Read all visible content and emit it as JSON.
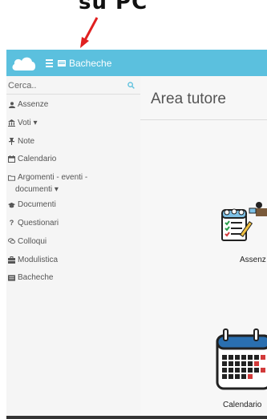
{
  "annotation": {
    "text": "su PC"
  },
  "topbar": {
    "menu_label": "Bacheche"
  },
  "sidebar": {
    "search_placeholder": "Cerca..",
    "items": [
      {
        "label": "Assenze",
        "icon": "user-icon"
      },
      {
        "label": "Voti ▾",
        "icon": "bank-icon"
      },
      {
        "label": "Note",
        "icon": "pin-icon"
      },
      {
        "label": "Calendario",
        "icon": "calendar-icon"
      },
      {
        "label": "Argomenti - eventi -",
        "label2": "documenti ▾",
        "icon": "folder-icon"
      },
      {
        "label": "Documenti",
        "icon": "graduation-cap-icon"
      },
      {
        "label": "Questionari",
        "icon": "question-icon"
      },
      {
        "label": "Colloqui",
        "icon": "chat-icon"
      },
      {
        "label": "Modulistica",
        "icon": "briefcase-icon"
      },
      {
        "label": "Bacheche",
        "icon": "board-icon"
      }
    ]
  },
  "main": {
    "title": "Area tutore",
    "tiles": [
      {
        "label": "Assenz",
        "icon": "attendance-icon"
      },
      {
        "label": "Calendario",
        "icon": "calendar-icon"
      }
    ]
  },
  "colors": {
    "topbar": "#5bc0de",
    "arrow": "#e02020"
  }
}
